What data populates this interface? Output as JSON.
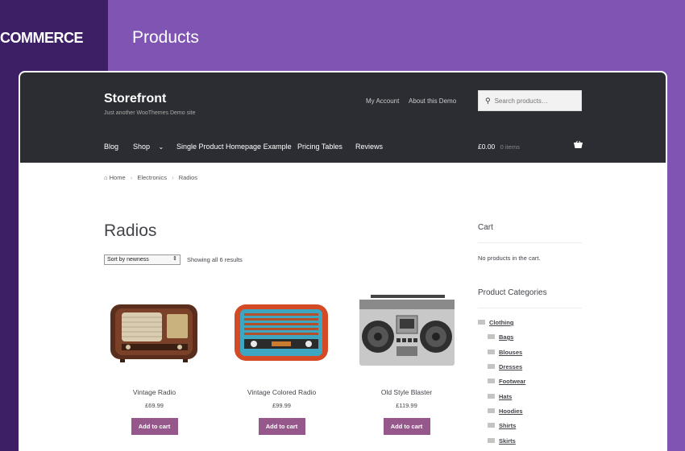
{
  "brand": {
    "logo_text": "COMMERCE",
    "page_title": "Products"
  },
  "site": {
    "title": "Storefront",
    "tagline": "Just another WooThemes Demo site"
  },
  "secondary_nav": [
    "My Account",
    "About this Demo"
  ],
  "search": {
    "placeholder": "Search products…"
  },
  "primary_nav": [
    {
      "label": "Blog"
    },
    {
      "label": "Shop",
      "has_dropdown": true
    },
    {
      "label": "Single Product Homepage Example"
    },
    {
      "label": "Pricing Tables"
    },
    {
      "label": "Reviews"
    }
  ],
  "cart_header": {
    "total": "£0.00",
    "items": "0 items"
  },
  "breadcrumb": [
    "Home",
    "Electronics",
    "Radios"
  ],
  "page": {
    "heading": "Radios",
    "sort_value": "Sort by newness",
    "result_count": "Showing all 6 results"
  },
  "products": [
    {
      "name": "Vintage Radio",
      "price": "£69.99",
      "button": "Add to cart"
    },
    {
      "name": "Vintage Colored Radio",
      "price": "£99.99",
      "button": "Add to cart"
    },
    {
      "name": "Old Style Blaster",
      "price": "£119.99",
      "button": "Add to cart"
    }
  ],
  "sidebar": {
    "cart_title": "Cart",
    "cart_empty": "No products in the cart.",
    "categories_title": "Product Categories",
    "categories": [
      {
        "label": "Clothing",
        "level": 0
      },
      {
        "label": "Bags",
        "level": 1
      },
      {
        "label": "Blouses",
        "level": 1
      },
      {
        "label": "Dresses",
        "level": 1
      },
      {
        "label": "Footwear",
        "level": 1
      },
      {
        "label": "Hats",
        "level": 1
      },
      {
        "label": "Hoodies",
        "level": 1
      },
      {
        "label": "Shirts",
        "level": 1
      },
      {
        "label": "Skirts",
        "level": 1
      }
    ]
  },
  "colors": {
    "purple": "#7f54b3",
    "dark_purple": "#3d1f66",
    "header_bg": "#2c2d33",
    "button": "#96588a"
  }
}
